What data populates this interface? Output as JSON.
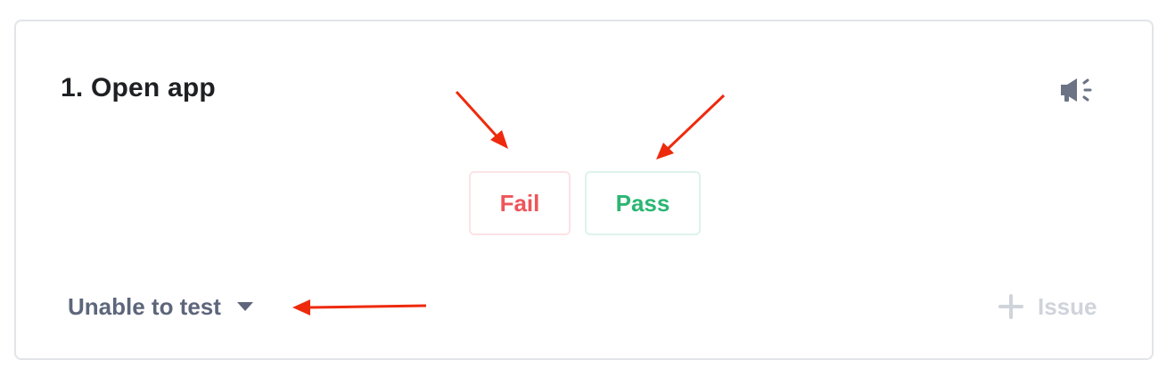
{
  "step": {
    "title": "1. Open app"
  },
  "buttons": {
    "fail_label": "Fail",
    "pass_label": "Pass"
  },
  "footer": {
    "unable_label": "Unable to test",
    "issue_label": "Issue"
  },
  "icons": {
    "announce": "megaphone-icon",
    "dropdown": "caret-down-icon",
    "add": "plus-icon"
  },
  "colors": {
    "fail": "#ef5459",
    "pass": "#2bb673",
    "annotation_arrow": "#ee2a0c",
    "muted_text": "#5d667a",
    "disabled_text": "#cfd3da"
  }
}
